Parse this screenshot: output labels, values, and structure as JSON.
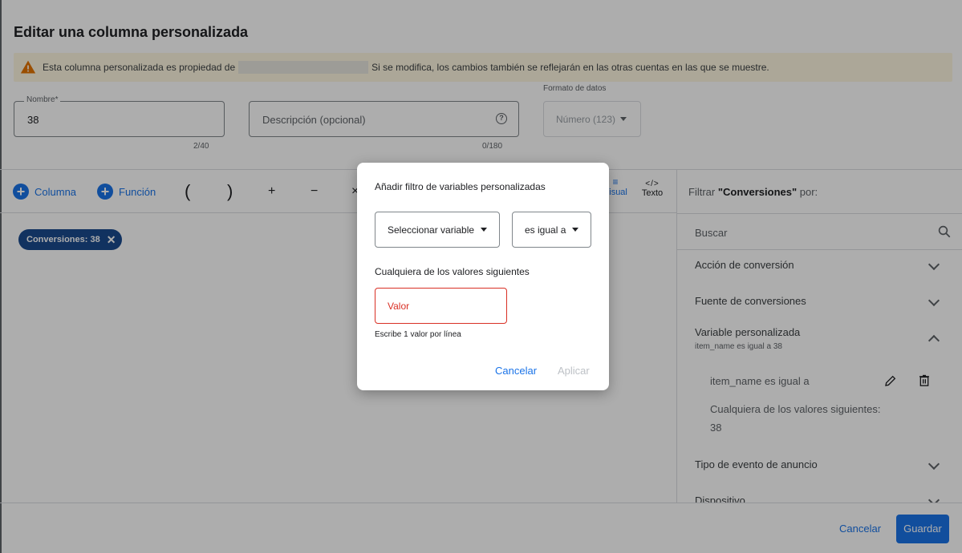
{
  "page": {
    "title": "Editar una columna personalizada",
    "warning": {
      "text_before": "Esta columna personalizada es propiedad de",
      "text_after": "Si se modifica, los cambios también se reflejarán en las otras cuentas en las que se muestre.",
      "icon": "warning-icon"
    }
  },
  "form": {
    "name": {
      "label": "Nombre*",
      "value": "38",
      "counter": "2/40"
    },
    "description": {
      "placeholder": "Descripción (opcional)",
      "counter": "0/180",
      "help_icon": "help-icon"
    },
    "format": {
      "label": "Formato de datos",
      "value": "Número (123)"
    }
  },
  "toolbar": {
    "column_label": "Columna",
    "function_label": "Función",
    "open_paren": "(",
    "close_paren": ")",
    "plus": "+",
    "minus": "−",
    "times": "×",
    "visual_label": "Visual",
    "text_label": "Texto",
    "text_icon": "</>"
  },
  "formula": {
    "chip_label": "Conversiones: 38"
  },
  "filter_panel": {
    "heading_prefix": "Filtrar ",
    "heading_bold": "\"Conversiones\"",
    "heading_suffix": " por:",
    "search_placeholder": "Buscar",
    "items": [
      {
        "label": "Acción de conversión"
      },
      {
        "label": "Fuente de conversiones"
      },
      {
        "label": "Variable personalizada",
        "sub": "item_name es igual a 38",
        "expanded": true
      },
      {
        "label": "Tipo de evento de anuncio"
      },
      {
        "label": "Dispositivo"
      }
    ],
    "detail": {
      "condition": "item_name es igual a",
      "values_label": "Cualquiera de los valores siguientes:",
      "value": "38"
    }
  },
  "footer": {
    "cancel_label": "Cancelar",
    "save_label": "Guardar"
  },
  "dialog": {
    "title": "Añadir filtro de variables personalizadas",
    "variable_select": "Seleccionar variable",
    "condition_select": "es igual a",
    "values_label": "Cualquiera de los valores siguientes",
    "value_placeholder": "Valor",
    "hint": "Escribe 1 valor por línea",
    "cancel_label": "Cancelar",
    "apply_label": "Aplicar"
  },
  "colors": {
    "accent": "#1a73e8",
    "chip": "#1a4a8e",
    "error": "#d93025",
    "warning_bg": "#fef7e0",
    "warning_icon": "#e37400"
  }
}
